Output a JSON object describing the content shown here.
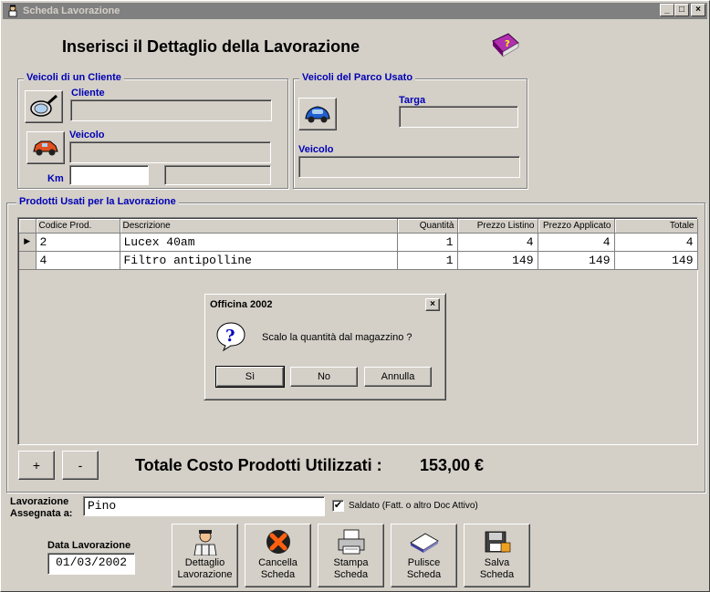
{
  "window": {
    "title": "Scheda Lavorazione",
    "minimize": "_",
    "maximize": "□",
    "close": "×"
  },
  "header": {
    "title": "Inserisci il Dettaglio della Lavorazione"
  },
  "cliente_group": {
    "title": "Veicoli di un Cliente",
    "cliente_label": "Cliente",
    "cliente_value": "",
    "veicolo_label": "Veicolo",
    "veicolo_value": "",
    "km_label": "Km",
    "km_value": "",
    "km_extra_value": ""
  },
  "usato_group": {
    "title": "Veicoli del Parco Usato",
    "targa_label": "Targa",
    "targa_value": "",
    "veicolo_label": "Veicolo",
    "veicolo_value": ""
  },
  "prodotti_group": {
    "title": "Prodotti Usati per la Lavorazione"
  },
  "grid": {
    "columns": [
      "Codice Prod.",
      "Descrizione",
      "Quantità",
      "Prezzo Listino",
      "Prezzo Applicato",
      "Totale"
    ],
    "rows": [
      {
        "codice": "2",
        "descrizione": "Lucex 40am",
        "quantita": "1",
        "listino": "4",
        "applicato": "4",
        "totale": "4"
      },
      {
        "codice": "4",
        "descrizione": "Filtro antipolline",
        "quantita": "1",
        "listino": "149",
        "applicato": "149",
        "totale": "149"
      }
    ]
  },
  "dialog": {
    "title": "Officina 2002",
    "close": "×",
    "message": "Scalo la quantità dal magazzino ?",
    "yes": "Sì",
    "no": "No",
    "cancel": "Annulla"
  },
  "totals": {
    "plus": "+",
    "minus": "-",
    "label": "Totale Costo Prodotti Utilizzati :",
    "value": "153,00 €"
  },
  "assegnazione": {
    "label_line1": "Lavorazione",
    "label_line2": "Assegnata a:",
    "value": "Pino",
    "saldato_label": "Saldato (Fatt. o altro Doc Attivo)",
    "saldato_checked": "✔"
  },
  "data_lavorazione": {
    "label": "Data Lavorazione",
    "value": "01/03/2002"
  },
  "actions": {
    "dettaglio": [
      "Dettaglio",
      "Lavorazione"
    ],
    "cancella": [
      "Cancella",
      "Scheda"
    ],
    "stampa": [
      "Stampa",
      "Scheda"
    ],
    "pulisce": [
      "Pulisce",
      "Scheda"
    ],
    "salva": [
      "Salva",
      "Scheda"
    ]
  },
  "colors": {
    "face": "#d4d0c8",
    "label_blue": "#0000b4",
    "inactive_title": "#808080"
  }
}
